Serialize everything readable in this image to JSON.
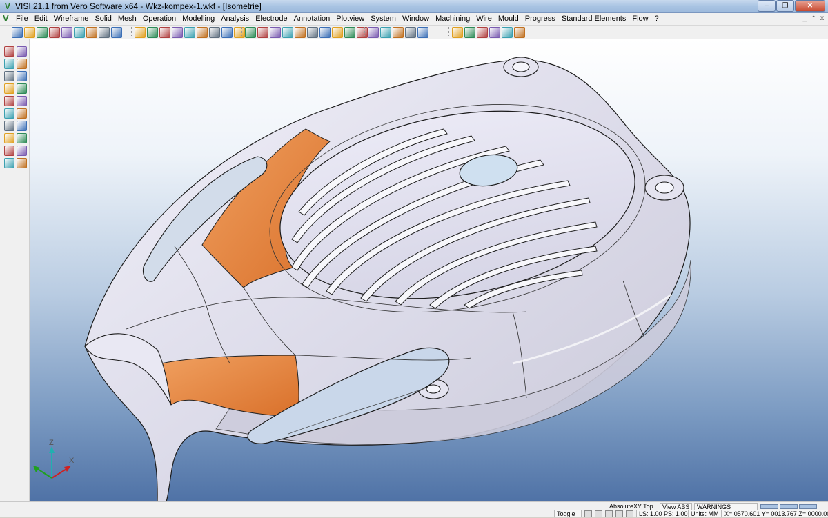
{
  "window": {
    "title": "VISI 21.1 from Vero Software x64 - Wkz-kompex-1.wkf - [Isometrie]",
    "buttons": {
      "minimize": "–",
      "maximize": "❐",
      "close": "✕"
    },
    "app_icon": "V"
  },
  "menubar": {
    "items": [
      "File",
      "Edit",
      "Wireframe",
      "Solid",
      "Mesh",
      "Operation",
      "Modelling",
      "Analysis",
      "Electrode",
      "Annotation",
      "Plotview",
      "System",
      "Window",
      "Machining",
      "Wire",
      "Mould",
      "Progress",
      "Standard Elements",
      "Flow",
      "?"
    ],
    "mdi": {
      "minimize": "_",
      "restore": "ᐩ",
      "close": "x"
    }
  },
  "viewport": {
    "axis": {
      "x": "X",
      "y": "Y",
      "z": "Z"
    },
    "colors": {
      "part": "#e2e1ee",
      "highlight": "#e07b35",
      "background_top": "#ffffff",
      "background_bottom": "#4f72a6"
    }
  },
  "statusbar": {
    "absolute": "Absolute",
    "plane": "XY Top",
    "view": "View ABS",
    "warnings": "WARNINGS",
    "toggle": "Toggle",
    "scale": "LS: 1.00 PS: 1.00",
    "units": "Units: MM",
    "coords": "X= 0570.601 Y= 0013.767 Z= 0000.000"
  },
  "icons": {
    "toolbar": [
      "new-icon",
      "open-icon",
      "open-recent-icon",
      "save-icon",
      "save-as-icon",
      "print-icon",
      "grid-icon",
      "frame-icon",
      "shade-icon",
      "wire-icon",
      "hidden-icon",
      "dynamic-icon",
      "shaded-active-icon",
      "render-icon",
      "globe-icon",
      "zoom-icon",
      "refresh-icon",
      "cylinder-icon",
      "layer-icon",
      "filter-icon",
      "panel-icon",
      "page-icon",
      "copy-icon",
      "selection-icon",
      "measure-icon",
      "dimension-icon",
      "annotate-icon",
      "tag-icon",
      "point-icon",
      "solid-box-icon",
      "mesh-icon",
      "hand-icon",
      "move-icon",
      "rotate-icon",
      "scale-icon",
      "mirror-icon",
      "link-icon",
      "color-icon",
      "cube-icon"
    ],
    "left": [
      "select-icon",
      "cursor-icon",
      "trim-icon",
      "extend-icon",
      "break-icon",
      "join-icon",
      "delete-icon",
      "offset-icon",
      "cut-icon",
      "project-icon",
      "rotate-icon",
      "camera-icon",
      "question-icon",
      "block-icon",
      "eraser-icon",
      "magnifier-icon",
      "wheel-icon",
      "window-icon",
      "arrow-left-icon",
      "arrow-right-icon"
    ]
  }
}
